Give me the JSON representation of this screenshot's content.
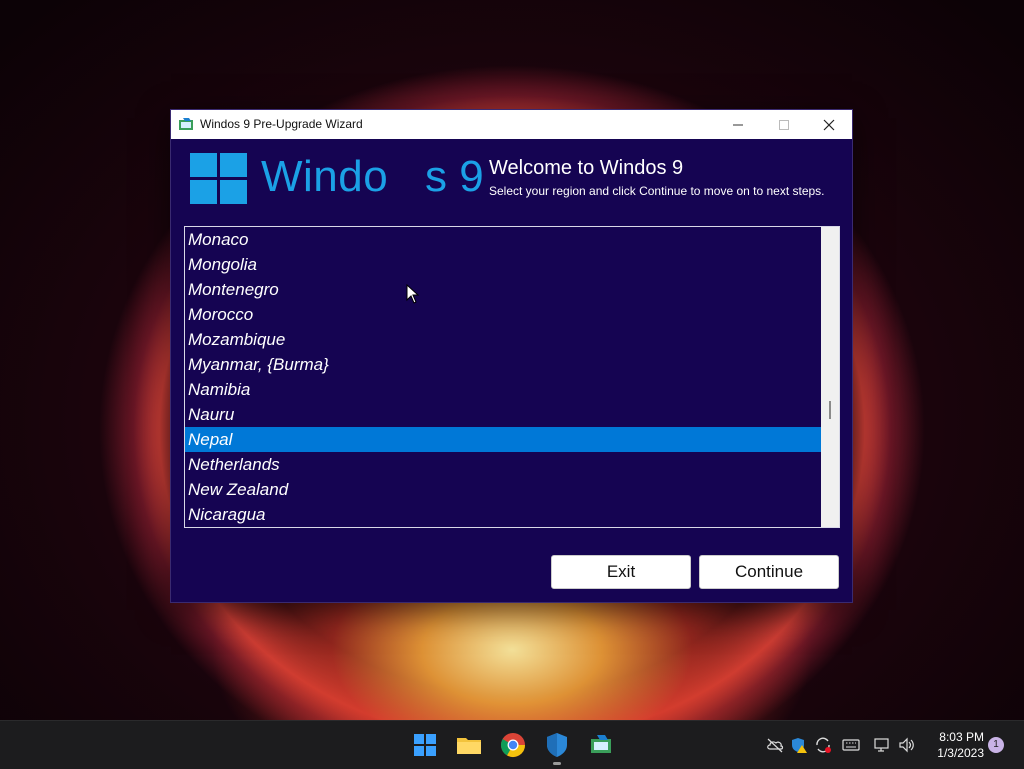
{
  "window": {
    "title": "Windos 9 Pre-Upgrade Wizard",
    "brand_text": "Windo",
    "brand_text_2": "s 9",
    "welcome_title": "Welcome to Windos 9",
    "welcome_subtitle": "Select your region and click Continue to move on to next steps."
  },
  "region_list": {
    "items": [
      "Monaco",
      "Mongolia",
      "Montenegro",
      "Morocco",
      "Mozambique",
      "Myanmar, {Burma}",
      "Namibia",
      "Nauru",
      "Nepal",
      "Netherlands",
      "New Zealand",
      "Nicaragua"
    ],
    "selected": "Nepal"
  },
  "buttons": {
    "exit_label": "Exit",
    "continue_label": "Continue"
  },
  "taskbar": {
    "time": "8:03 PM",
    "date": "1/3/2023",
    "notification_count": "1"
  },
  "colors": {
    "window_bg": "#150452",
    "accent": "#1ba1e6",
    "selection": "#0078d7"
  }
}
